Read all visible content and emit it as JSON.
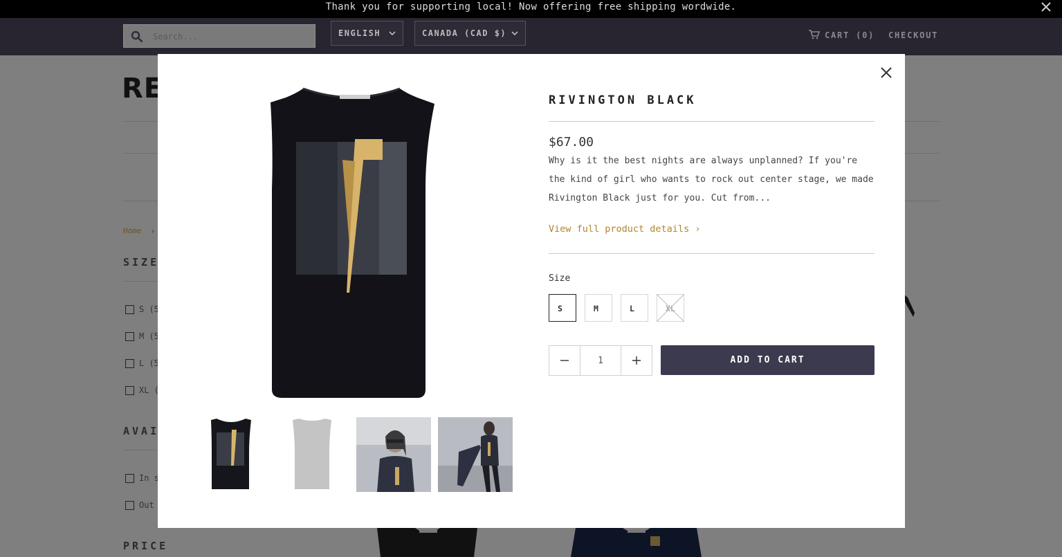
{
  "announcement": {
    "text": "Thank you for supporting local! Now offering free shipping wordwide."
  },
  "header": {
    "search_placeholder": "Search...",
    "language": "ENGLISH",
    "currency": "CANADA (CAD $)",
    "cart": "CART (0)",
    "checkout": "CHECKOUT"
  },
  "background": {
    "brand_fragment": "RES",
    "breadcrumb_home": "Home",
    "breadcrumb_sep": "›",
    "size_heading": "SIZE",
    "size_filters": [
      "S (5",
      "M (5",
      "L (5",
      "XL ("
    ],
    "availability_heading": "AVAIL",
    "availability_filters": [
      "In s",
      "Out"
    ],
    "price_heading": "PRICE"
  },
  "product": {
    "title": "RIVINGTON BLACK",
    "price": "$67.00",
    "description": "Why is it the best nights are always unplanned? If you're the kind of girl who wants to rock out center stage, we made Rivington Black just for you. Cut from...",
    "details_link": "View full product details ›",
    "size_label": "Size",
    "sizes": [
      "S",
      "M",
      "L",
      "XL"
    ],
    "selected_size": "S",
    "unavailable_size": "XL",
    "quantity": "1",
    "add_to_cart": "ADD TO CART"
  },
  "colors": {
    "accent_link": "#b0862a",
    "button": "#3c3a4f",
    "header": "#282530"
  }
}
